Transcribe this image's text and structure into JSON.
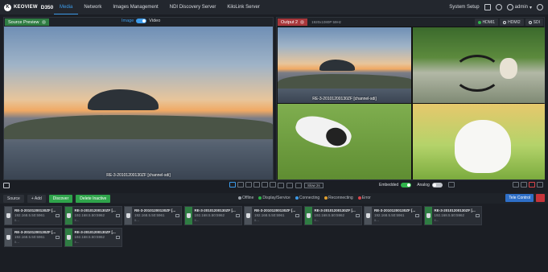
{
  "brand": {
    "name": "KEOVIEW",
    "model": "D350"
  },
  "nav": {
    "items": [
      "Media",
      "Network",
      "Images Management",
      "NDI Discovery Server",
      "KiloLink Server"
    ],
    "active": "Media"
  },
  "top_right": {
    "system_setup": "System Setup",
    "user": "admin"
  },
  "preview": {
    "title": "Source Preview",
    "image_label": "Image",
    "video_label": "Video",
    "channel": "RE-3-20101200130ZF [channel-sdi]"
  },
  "output": {
    "title": "Output 2",
    "resolution": "1920x1080P 59Hz",
    "hdmi_tabs": [
      "HDMI1",
      "HDMI2",
      "SDI"
    ],
    "active_tab": "HDMI1",
    "main_channel": "RE-3-20101200130ZF [channel-sdi]",
    "speed": "Slow 2s",
    "embedded_label": "Embedded",
    "analog_label": "Analog"
  },
  "toolbar": {
    "source": "Source",
    "add": "+ Add",
    "discover": "Discover",
    "delete": "Delete Inactive",
    "tele_control": "Tele Control"
  },
  "legend": [
    {
      "label": "Offline",
      "color": "#9aa0a8"
    },
    {
      "label": "Display/Service",
      "color": "#2fb34b"
    },
    {
      "label": "Connecting",
      "color": "#3d9be9"
    },
    {
      "label": "Reconnecting",
      "color": "#e0a030"
    },
    {
      "label": "Error",
      "color": "#d9454b"
    }
  ],
  "cards": [
    {
      "name": "RE-3-20101200130ZF [...",
      "ip": "192.168.5.50:5961",
      "x": "x...",
      "status": "gray"
    },
    {
      "name": "RE-3-20101200130ZF [...",
      "ip": "192.168.5.50:5962",
      "x": "x...",
      "status": "green"
    },
    {
      "name": "RE-3-20101200130ZF [...",
      "ip": "192.168.5.50:5961",
      "x": "x...",
      "status": "gray"
    },
    {
      "name": "RE-3-20101200130ZF [...",
      "ip": "192.168.5.50:5962",
      "x": "x...",
      "status": "green"
    },
    {
      "name": "RE-3-20101200130ZF [...",
      "ip": "192.168.5.50:5961",
      "x": "x...",
      "status": "gray"
    },
    {
      "name": "RE-3-20101200130ZF [...",
      "ip": "192.168.5.50:5962",
      "x": "x...",
      "status": "green"
    },
    {
      "name": "RE-3-20101200130ZF [...",
      "ip": "192.168.5.50:5961",
      "x": "x...",
      "status": "gray"
    },
    {
      "name": "RE-3-20101200130ZF [...",
      "ip": "192.168.5.50:5962",
      "x": "x...",
      "status": "green"
    },
    {
      "name": "RE-3-20101200130ZF [...",
      "ip": "192.168.5.50:5961",
      "x": "x...",
      "status": "gray"
    },
    {
      "name": "RE-3-20101200130ZF [...",
      "ip": "192.168.5.50:5962",
      "x": "x...",
      "status": "green"
    }
  ]
}
